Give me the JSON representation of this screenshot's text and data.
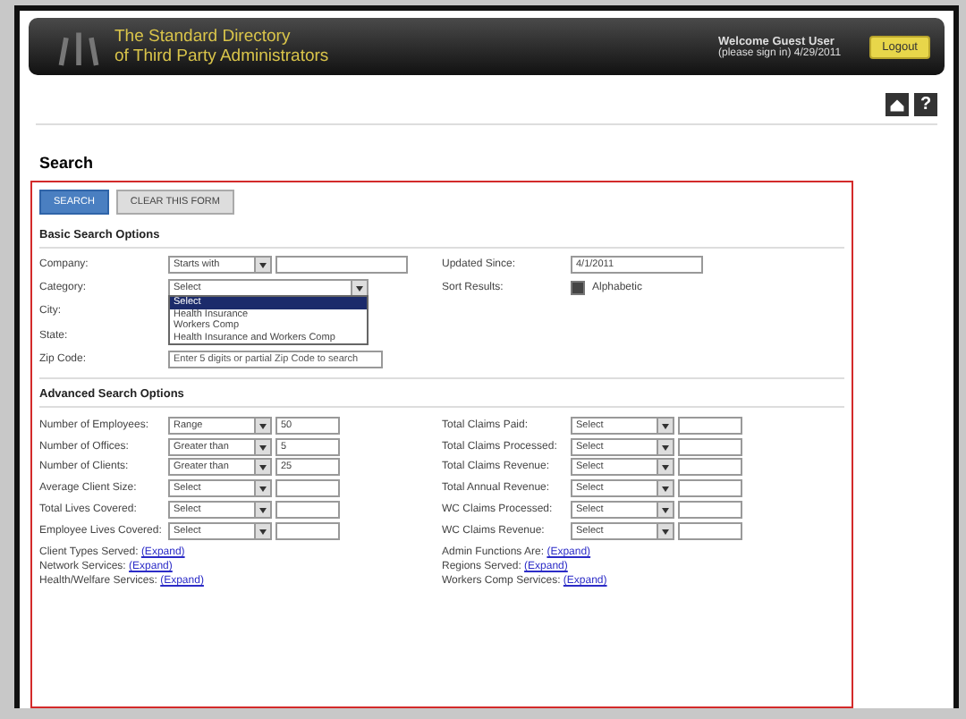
{
  "header": {
    "title_lines": [
      "The Standard Directory",
      "of Third Party Administrators"
    ],
    "welcome": "Welcome Guest User",
    "account": "(please sign in) 4/29/2011",
    "logout": "Logout"
  },
  "help": "?",
  "page_title": "Search",
  "buttons": [
    {
      "label": "SEARCH",
      "kind": "primary"
    },
    {
      "label": "CLEAR THIS FORM",
      "kind": "secondary"
    }
  ],
  "basic": {
    "heading": "Basic Search Options",
    "left": [
      {
        "label": "Company:",
        "kind": "select-text",
        "select": "Starts with"
      },
      {
        "label": "Category:",
        "kind": "dropdown",
        "select": "Select",
        "options": [
          {
            "label": "Select",
            "selected": true
          },
          {
            "label": "Health Insurance",
            "selected": false
          },
          {
            "label": "Workers Comp",
            "selected": false
          },
          {
            "label": "Health Insurance and Workers Comp",
            "selected": false
          }
        ]
      },
      {
        "label": "City:",
        "kind": "blank"
      },
      {
        "label": "State:",
        "kind": "blank"
      },
      {
        "label": "Zip Code:",
        "kind": "text",
        "placeholder": "Enter 5 digits or partial Zip Code to search"
      }
    ],
    "right": [
      {
        "label": "Updated Since:",
        "kind": "text",
        "value": "4/1/2011"
      },
      {
        "label": "Sort Results:",
        "kind": "checkbox",
        "checked": true,
        "text": "Alphabetic"
      }
    ]
  },
  "advanced": {
    "heading": "Advanced Search Options",
    "left": [
      {
        "label": "Number of Employees:",
        "select": "Range",
        "value": "50"
      },
      {
        "label": "Number of Offices:",
        "select": "Greater than",
        "value": "5"
      },
      {
        "label": "Number of Clients:",
        "select": "Greater than",
        "value": "25"
      },
      {
        "label": "Average Client Size:",
        "select": "Select"
      },
      {
        "label": "Total Lives Covered:",
        "select": "Select"
      },
      {
        "label": "Employee Lives Covered:",
        "select": "Select"
      }
    ],
    "right": [
      {
        "label": "Total Claims Paid:",
        "select": "Select"
      },
      {
        "label": "Total Claims Processed:",
        "select": "Select"
      },
      {
        "label": "Total Claims Revenue:",
        "select": "Select"
      },
      {
        "label": "Total Annual Revenue:",
        "select": "Select"
      },
      {
        "label": "WC Claims Processed:",
        "select": "Select"
      },
      {
        "label": "WC Claims Revenue:",
        "select": "Select"
      }
    ],
    "left_links": [
      {
        "label": "Client Types Served:",
        "link": "(Expand)"
      },
      {
        "label": "Network Services:",
        "link": "(Expand)"
      },
      {
        "label": "Health/Welfare Services:",
        "link": "(Expand)"
      }
    ],
    "right_links": [
      {
        "label": "Admin Functions Are:",
        "link": "(Expand)"
      },
      {
        "label": "Regions Served:",
        "link": "(Expand)"
      },
      {
        "label": "Workers Comp Services:",
        "link": "(Expand)"
      }
    ]
  }
}
